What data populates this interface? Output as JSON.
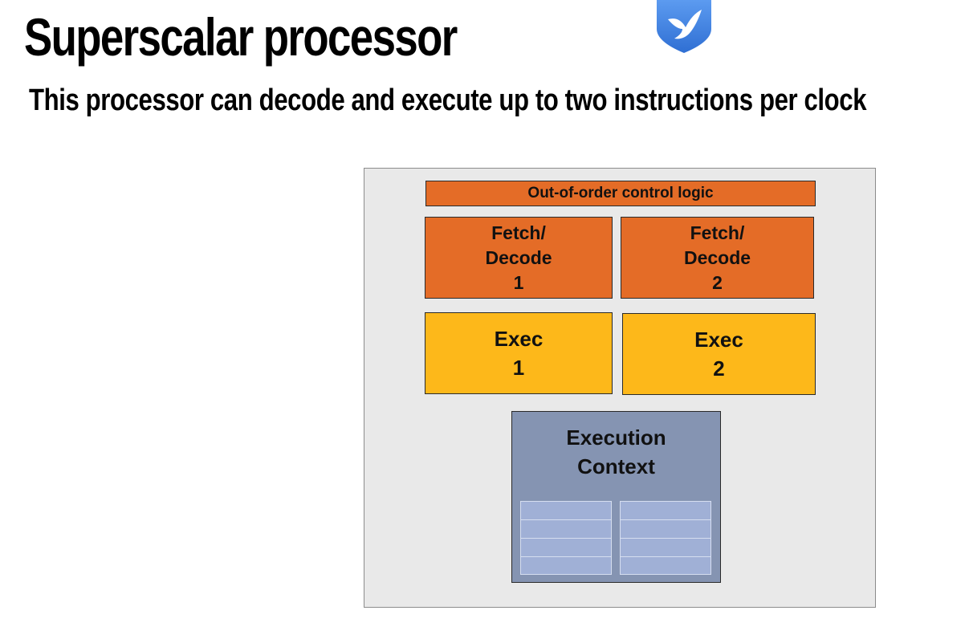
{
  "slide": {
    "title": "Superscalar processor",
    "subtitle": "This processor can decode and execute up to two instructions per clock"
  },
  "logo": {
    "icon": "bird-shield-icon",
    "color": "#3f7fdc"
  },
  "diagram": {
    "control_logic": "Out-of-order control logic",
    "fetch_decode": [
      {
        "line1": "Fetch/",
        "line2": "Decode",
        "number": "1"
      },
      {
        "line1": "Fetch/",
        "line2": "Decode",
        "number": "2"
      }
    ],
    "exec": [
      {
        "label": "Exec",
        "number": "1"
      },
      {
        "label": "Exec",
        "number": "2"
      }
    ],
    "execution_context": {
      "line1": "Execution",
      "line2": "Context"
    },
    "colors": {
      "chip_background": "#e9e9e9",
      "control": "#e46c27",
      "fetch_decode": "#e46c27",
      "exec": "#fdb81a",
      "context": "#8594b2",
      "registers": "#a0b0d6"
    }
  }
}
